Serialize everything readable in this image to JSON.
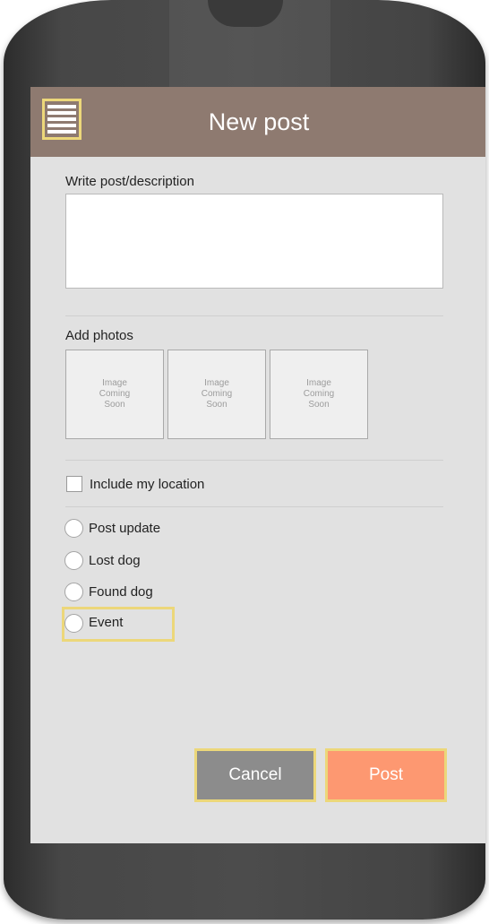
{
  "header": {
    "title": "New post",
    "menu_icon": "hamburger-menu-icon"
  },
  "form": {
    "description_label": "Write post/description",
    "description_value": "",
    "photos_label": "Add photos",
    "photos": [
      {
        "placeholder": "Image\nComing\nSoon"
      },
      {
        "placeholder": "Image\nComing\nSoon"
      },
      {
        "placeholder": "Image\nComing\nSoon"
      }
    ],
    "location_label": "Include my location",
    "location_checked": false,
    "post_types": [
      {
        "label": "Post update",
        "selected": false
      },
      {
        "label": "Lost dog",
        "selected": false
      },
      {
        "label": "Found dog",
        "selected": false
      },
      {
        "label": "Event",
        "selected": false
      }
    ]
  },
  "actions": {
    "cancel_label": "Cancel",
    "post_label": "Post"
  },
  "colors": {
    "header": "#8e7a70",
    "screen": "#e1e1e1",
    "cancel": "#8c8c8c",
    "post": "#fd9871",
    "highlight": "#ecd77a"
  }
}
